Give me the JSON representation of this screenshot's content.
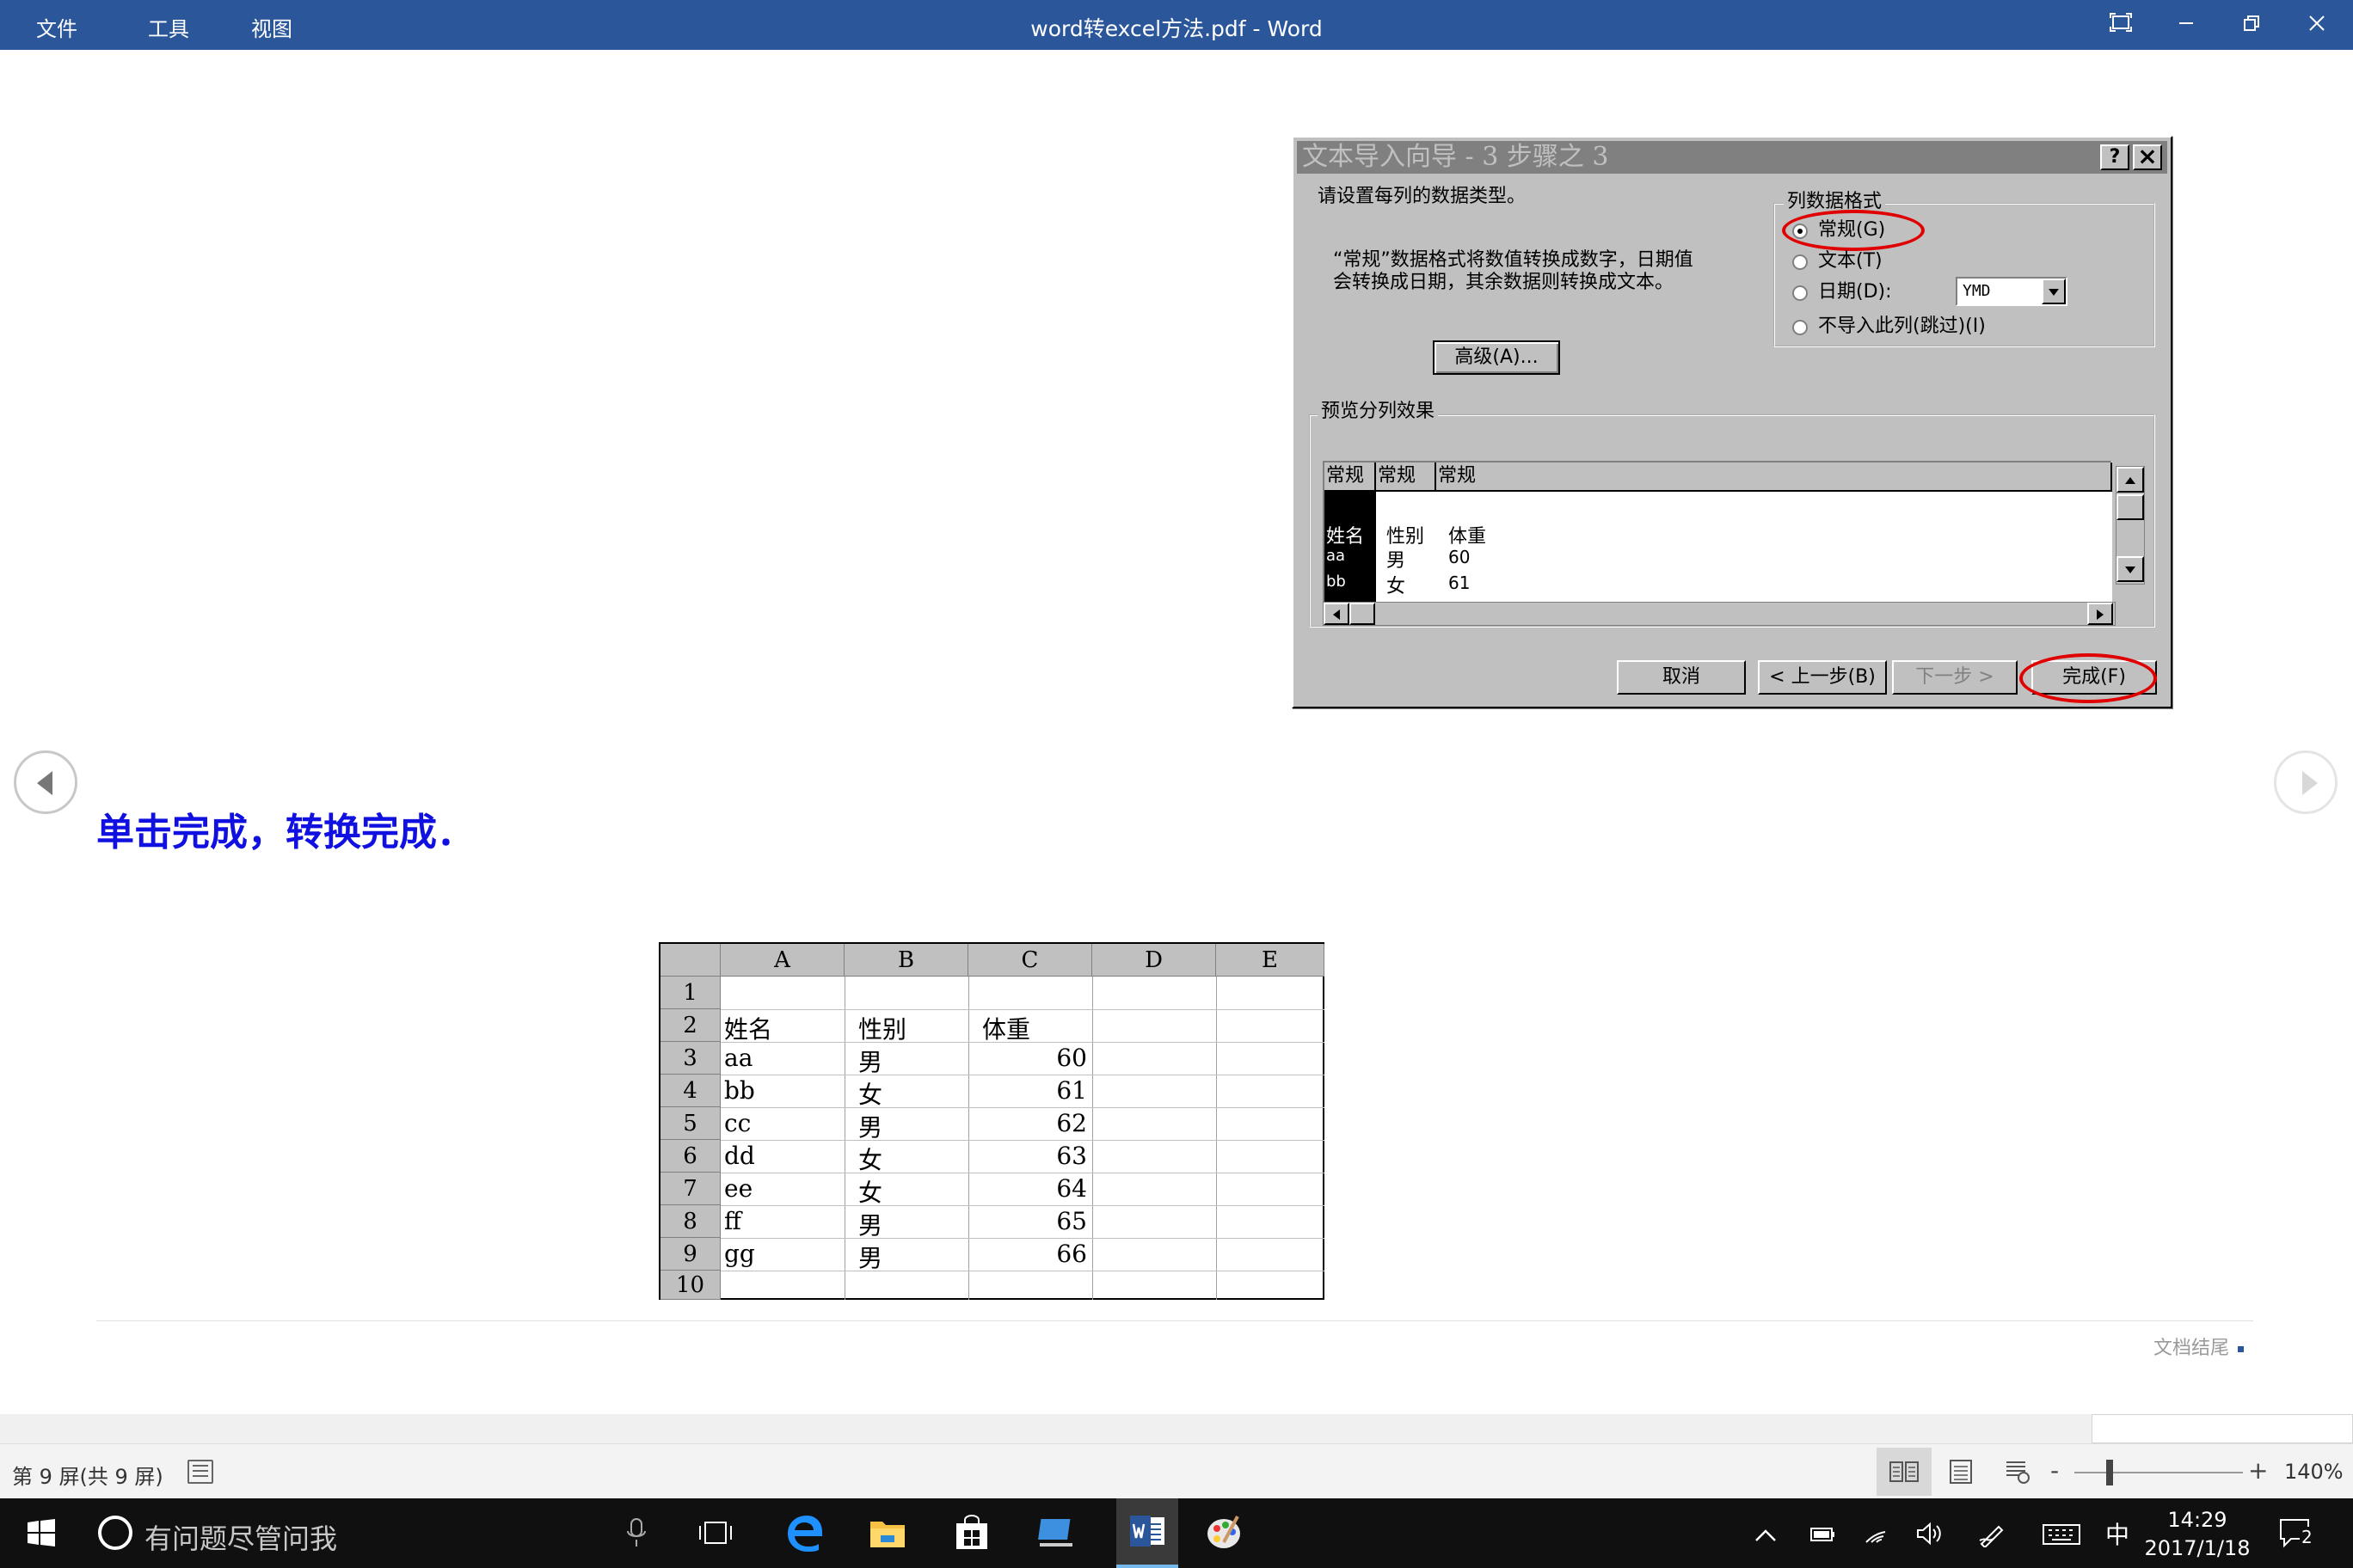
{
  "titlebar": {
    "menus": [
      "文件",
      "工具",
      "视图"
    ],
    "title": "word转excel方法.pdf  -  Word",
    "fullscreen_icon": "fullscreen-icon",
    "min_icon": "minimize-icon",
    "restore_icon": "restore-icon",
    "close_icon": "close-icon"
  },
  "dialog": {
    "title": "文本导入向导 - 3 步骤之 3",
    "help": "?",
    "close": "×",
    "instruction": "请设置每列的数据类型。",
    "desc_line1": "“常规”数据格式将数值转换成数字，日期值",
    "desc_line2": "会转换成日期，其余数据则转换成文本。",
    "advanced": "高级(A)...",
    "format_group": "列数据格式",
    "options": [
      "常规(G)",
      "文本(T)",
      "日期(D):",
      "不导入此列(跳过)(I)"
    ],
    "date_value": "YMD",
    "preview_label": "预览分列效果",
    "preview_headers": [
      "常规",
      "常规",
      "常规"
    ],
    "preview_rows": [
      [
        "姓名",
        "性别",
        "体重"
      ],
      [
        "aa",
        "男",
        "60"
      ],
      [
        "bb",
        "女",
        "61"
      ]
    ],
    "buttons": {
      "cancel": "取消",
      "back": "< 上一步(B)",
      "next": "下一步 >",
      "finish": "完成(F)"
    }
  },
  "caption": "单击完成，转换完成．",
  "sheet": {
    "columns": [
      "A",
      "B",
      "C",
      "D",
      "E"
    ],
    "rows": [
      "1",
      "2",
      "3",
      "4",
      "5",
      "6",
      "7",
      "8",
      "9",
      "10"
    ],
    "data": [
      [
        "",
        "",
        ""
      ],
      [
        "姓名",
        "性别",
        "体重"
      ],
      [
        "aa",
        "男",
        "60"
      ],
      [
        "bb",
        "女",
        "61"
      ],
      [
        "cc",
        "男",
        "62"
      ],
      [
        "dd",
        "女",
        "63"
      ],
      [
        "ee",
        "女",
        "64"
      ],
      [
        "ff",
        "男",
        "65"
      ],
      [
        "gg",
        "男",
        "66"
      ],
      [
        "",
        "",
        ""
      ]
    ]
  },
  "end_mark": "文档结尾",
  "status": {
    "page": "第 9 屏(共 9 屏)",
    "zoom": "140%",
    "minus": "-",
    "plus": "+"
  },
  "taskbar": {
    "search_placeholder": "有问题尽管问我",
    "time": "14:29",
    "date": "2017/1/18",
    "ime": "中",
    "notifications": "2"
  }
}
